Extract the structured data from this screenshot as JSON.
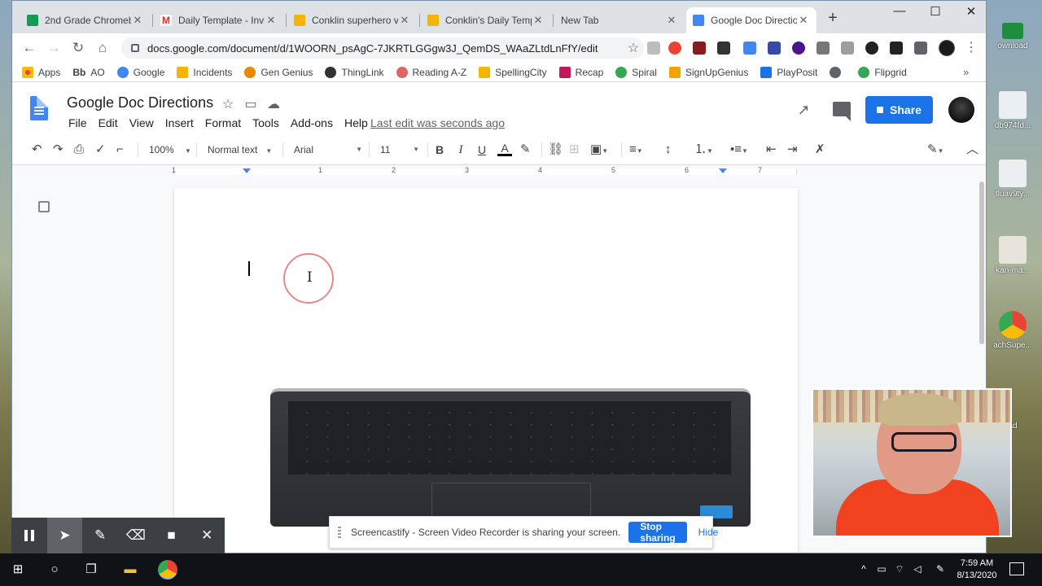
{
  "browser": {
    "tabs": [
      {
        "title": "2nd Grade Chromeb",
        "favicon_color": "#0f9d58"
      },
      {
        "title": "Daily Template - Invi",
        "favicon_color": "#d93025"
      },
      {
        "title": "Conklin superhero vi",
        "favicon_color": "#f4b400"
      },
      {
        "title": "Conklin's Daily Temp",
        "favicon_color": "#f4b400"
      },
      {
        "title": "New Tab",
        "favicon_color": ""
      },
      {
        "title": "Google Doc Directio",
        "favicon_color": "#4285f4"
      }
    ],
    "url": "docs.google.com/document/d/1WOORN_psAgC-7JKRTLGGgw3J_QemDS_WAaZLtdLnFfY/edit",
    "bookmarks": [
      {
        "label": "Apps",
        "color": "#ea4335"
      },
      {
        "label": "AO",
        "color": ""
      },
      {
        "label": "Google",
        "color": "#4285f4"
      },
      {
        "label": "Incidents",
        "color": "#f4b400"
      },
      {
        "label": "Gen Genius",
        "color": "#ea8600"
      },
      {
        "label": "ThingLink",
        "color": "#333333"
      },
      {
        "label": "Reading A-Z",
        "color": "#e06666"
      },
      {
        "label": "SpellingCity",
        "color": "#f4b400"
      },
      {
        "label": "Recap",
        "color": "#c2185b"
      },
      {
        "label": "Spiral",
        "color": "#34a853"
      },
      {
        "label": "SignUpGenius",
        "color": "#f4a300"
      },
      {
        "label": "PlayPosit",
        "color": "#1a73e8"
      },
      {
        "label": "",
        "color": "#5f6368"
      },
      {
        "label": "Flipgrid",
        "color": "#34a853"
      }
    ],
    "bookmark_prefix": "Bb"
  },
  "docs": {
    "title": "Google Doc Directions",
    "menu": [
      "File",
      "Edit",
      "View",
      "Insert",
      "Format",
      "Tools",
      "Add-ons",
      "Help"
    ],
    "last_edit": "Last edit was seconds ago",
    "share_label": "Share",
    "toolbar": {
      "zoom": "100%",
      "style": "Normal text",
      "font": "Arial",
      "size": "11",
      "bold": "B",
      "italic": "I",
      "underline": "U",
      "text_color": "A"
    },
    "ruler_numbers": [
      "1",
      "1",
      "2",
      "3",
      "4",
      "5",
      "6",
      "7"
    ]
  },
  "screencastify": {
    "message": "Screencastify - Screen Video Recorder is sharing your screen.",
    "stop_label": "Stop sharing",
    "hide_label": "Hide"
  },
  "desktop": {
    "icons": [
      {
        "label": "ownload"
      },
      {
        "label": "db974fd..."
      },
      {
        "label": "tluav9ty..."
      },
      {
        "label": "kan-ma..."
      },
      {
        "label": "achSupe..."
      },
      {
        "label": "ad"
      }
    ]
  },
  "taskbar": {
    "time": "7:59 AM",
    "date": "8/13/2020"
  },
  "colors": {
    "accent": "#1a73e8",
    "chrome_tabstrip": "#dee1e6",
    "webcam_shirt": "#f0421f"
  }
}
